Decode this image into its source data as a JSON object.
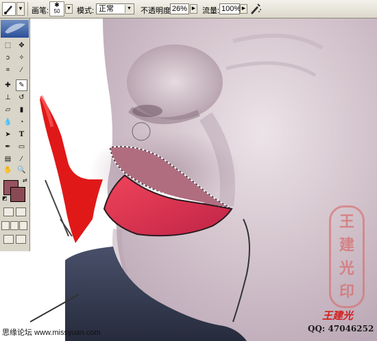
{
  "options_bar": {
    "brush_label": "画笔:",
    "brush_size": "50",
    "mode_label": "模式:",
    "mode_value": "正常",
    "opacity_label": "不透明度:",
    "opacity_value": "26%",
    "flow_label": "流量:",
    "flow_value": "100%"
  },
  "toolbox": {
    "foreground_color": "#97525f",
    "background_color": "#8a4a55",
    "tools": [
      "marquee-icon",
      "move-icon",
      "lasso-icon",
      "magic-wand-icon",
      "crop-icon",
      "slice-icon",
      "healing-icon",
      "brush-icon",
      "stamp-icon",
      "history-brush-icon",
      "eraser-icon",
      "gradient-icon",
      "blur-icon",
      "dodge-icon",
      "path-select-icon",
      "type-icon",
      "pen-icon",
      "shape-icon",
      "notes-icon",
      "eyedropper-icon",
      "hand-icon",
      "zoom-icon"
    ]
  },
  "watermark": {
    "seal_chars": [
      "王",
      "建",
      "光",
      "印"
    ],
    "signature": "王建光",
    "qq": "QQ: 47046252",
    "site": "思缘论坛 www.missyuan.com"
  }
}
